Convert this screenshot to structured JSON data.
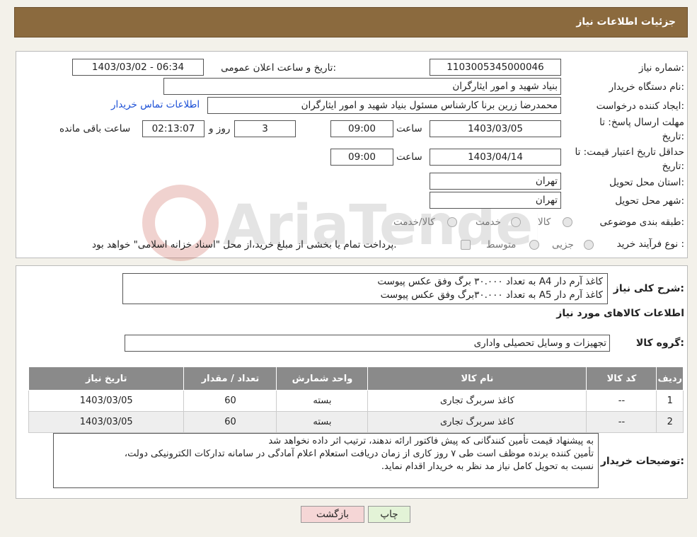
{
  "header": {
    "title": "جزئیات اطلاعات نیاز"
  },
  "labels": {
    "need_number": "شماره نیاز:",
    "announce_datetime": "تاریخ و ساعت اعلان عمومی:",
    "buyer_org": "نام دستگاه خریدار:",
    "requester": "ایجاد کننده درخواست:",
    "reply_deadline": "مهلت ارسال پاسخ: تا تاریخ:",
    "price_validity": "حداقل تاریخ اعتبار قیمت: تا تاریخ:",
    "time": "ساعت",
    "days_and": "روز و",
    "remaining": "ساعت باقی مانده",
    "province": "استان محل تحویل:",
    "city": "شهر محل تحویل:",
    "category": "طبقه بندی موضوعی:",
    "purchase_type": "نوع فرآیند خرید :",
    "general_desc": "شرح کلی نیاز:",
    "goods_info": "اطلاعات کالاهای مورد نیاز",
    "goods_group": "گروه کالا:",
    "buyer_notes": "توضیحات خریدار:"
  },
  "values": {
    "need_number": "1103005345000046",
    "announce_datetime": "1403/03/02 - 06:34",
    "buyer_org": "بنیاد شهید و امور ایثارگران",
    "requester": "محمدرضا زرین برنا کارشناس مسئول  بنیاد شهید و امور ایثارگران",
    "contact_link": "اطلاعات تماس خریدار",
    "reply_date": "1403/03/05",
    "reply_time": "09:00",
    "days": "3",
    "remaining_time": "02:13:07",
    "validity_date": "1403/04/14",
    "validity_time": "09:00",
    "province": "تهران",
    "city": "تهران",
    "goods_group": "تجهیزات و وسایل تحصیلی واداری"
  },
  "category_options": [
    "کالا",
    "خدمت",
    "کالا/خدمت"
  ],
  "purchase_options": [
    "جزیی",
    "متوسط"
  ],
  "purchase_note": "پرداخت تمام یا بخشی از مبلغ خرید،از محل \"اسناد خزانه اسلامی\" خواهد بود.",
  "general_desc_lines": [
    "کاغذ آرم دار A4 به تعداد ۳۰.۰۰۰ برگ وفق عکس پیوست",
    "کاغذ  آرم دار A5 به تعداد ۳۰.۰۰۰برگ وفق عکس پیوست"
  ],
  "table": {
    "headers": [
      "ردیف",
      "کد کالا",
      "نام کالا",
      "واحد شمارش",
      "تعداد / مقدار",
      "تاریخ نیاز"
    ],
    "rows": [
      [
        "1",
        "--",
        "کاغذ سربرگ تجاری",
        "بسته",
        "60",
        "1403/03/05"
      ],
      [
        "2",
        "--",
        "کاغذ سربرگ تجاری",
        "بسته",
        "60",
        "1403/03/05"
      ]
    ]
  },
  "buyer_notes_lines": [
    "به پیشنهاد قیمت تأمین کنندگانی که پیش فاکتور ارائه ندهند، ترتیب اثر داده نخواهد شد",
    "تأمین کننده برنده موظف است طی ۷ روز کاری از زمان دریافت استعلام اعلام آمادگی در سامانه تدارکات الکترونیکی دولت،",
    "نسبت به تحویل کامل نیاز مد نظر به خریدار اقدام نماید."
  ],
  "buttons": {
    "back": "بازگشت",
    "print": "چاپ"
  },
  "colors": {
    "header_bg": "#8b6a3e",
    "link": "#1b4fd6",
    "back_btn_bg": "#f5d6d6",
    "print_btn_bg": "#e3f3d7"
  },
  "watermark": "AriaTender.neT"
}
